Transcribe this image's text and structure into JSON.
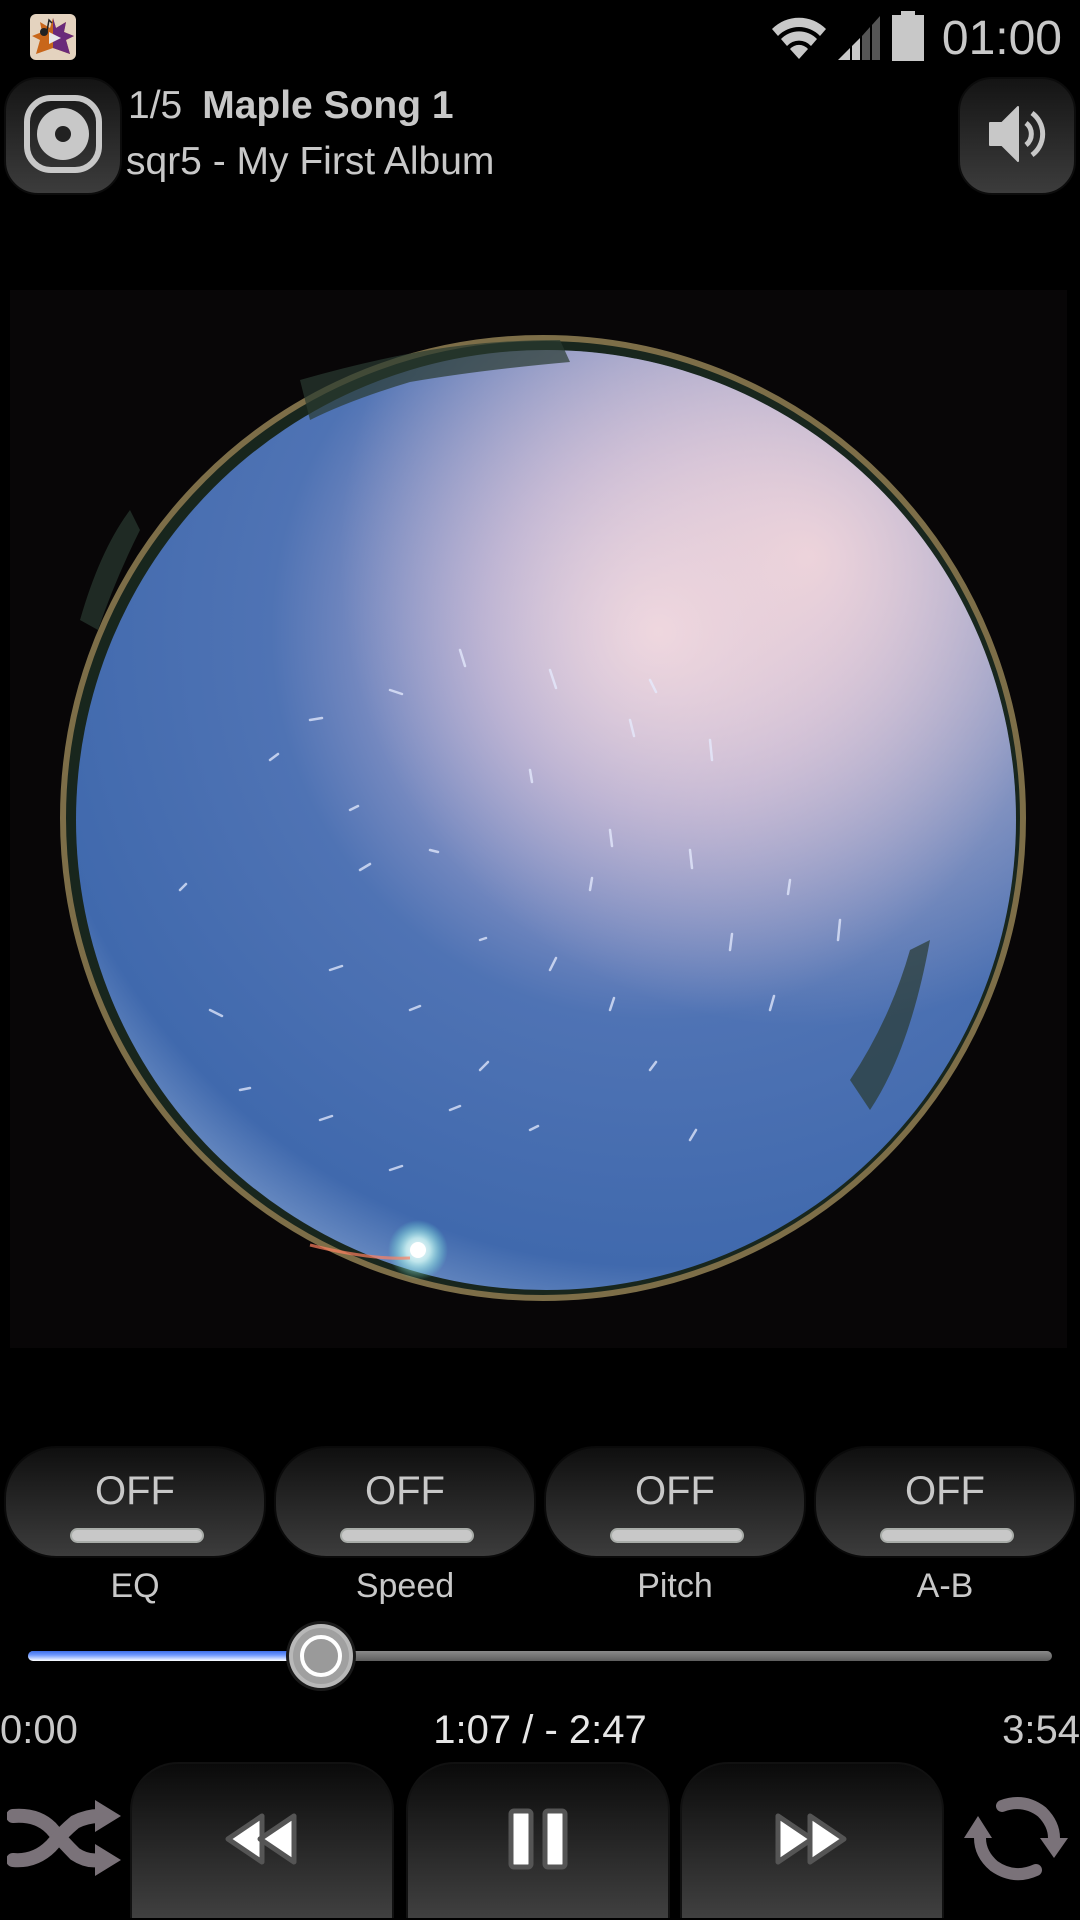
{
  "status_bar": {
    "time": "01:00",
    "icons": [
      "app-notification-icon",
      "wifi-icon",
      "cell-signal-icon",
      "battery-icon"
    ]
  },
  "header": {
    "track_index": "1/5",
    "track_title": "Maple Song 1",
    "artist_album": "sqr5 - My First Album",
    "left_button_icon": "disc-icon",
    "right_button_icon": "volume-icon"
  },
  "album_art": {
    "description": "Fisheye night sky star trails"
  },
  "toggles": [
    {
      "state": "OFF",
      "label": "EQ"
    },
    {
      "state": "OFF",
      "label": "Speed"
    },
    {
      "state": "OFF",
      "label": "Pitch"
    },
    {
      "state": "OFF",
      "label": "A-B"
    }
  ],
  "playback": {
    "elapsed": "1:07",
    "remaining": "- 2:47",
    "position_display": "1:07 / - 2:47",
    "start": "0:00",
    "duration": "3:54",
    "progress_fraction": 0.286
  },
  "transport": {
    "shuffle_icon": "shuffle-icon",
    "rewind_icon": "rewind-icon",
    "pause_icon": "pause-icon",
    "fast_forward_icon": "fast-forward-icon",
    "repeat_icon": "repeat-icon"
  },
  "colors": {
    "seek_fill": "#5a88f5",
    "seek_track": "#707070",
    "text": "#c8c8c8",
    "background": "#000000",
    "icon_gray": "#7a7279"
  }
}
